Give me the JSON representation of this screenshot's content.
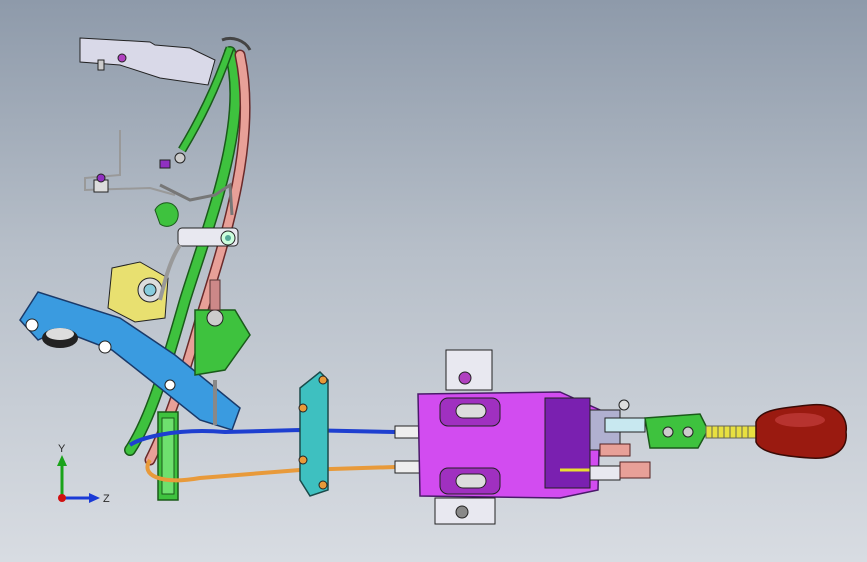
{
  "viewport": {
    "background_top": "#8e9aaa",
    "background_bottom": "#d8dce2"
  },
  "triad": {
    "y_label": "Y",
    "z_label": "Z",
    "y_color": "#1aa31a",
    "z_color": "#1a3ad6",
    "x_color": "#d01010"
  },
  "colors": {
    "cable_blue": "#1e3fd0",
    "cable_orange": "#e89a3a",
    "support_green": "#3ec23e",
    "support_salmon": "#e8a098",
    "bracket_blue": "#3a9be0",
    "housing_magenta": "#d24cf0",
    "knob_red": "#9a1a10",
    "bracket_yellow": "#e8e070",
    "sheet_metal": "#d9d9e8"
  }
}
